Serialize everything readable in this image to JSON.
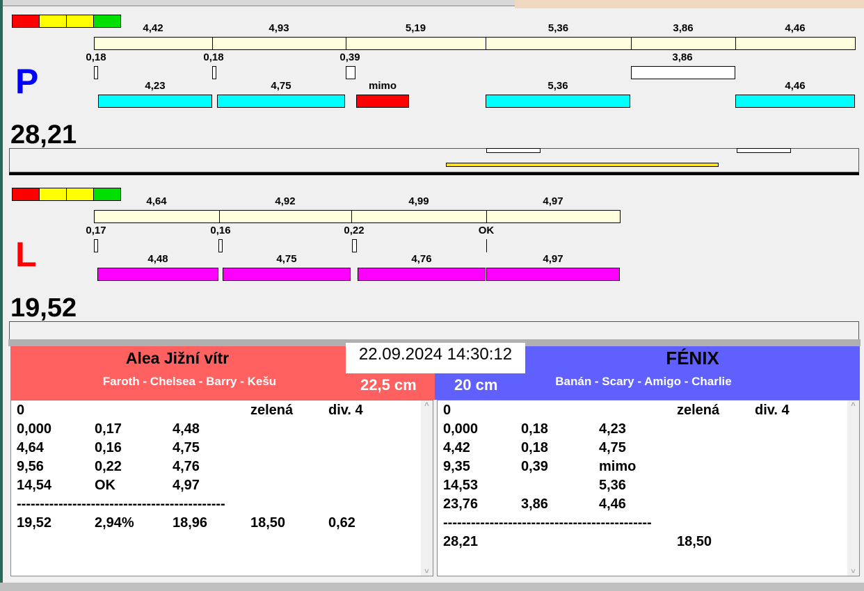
{
  "colors": {
    "red": "#ff0000",
    "yellow": "#ffff00",
    "green": "#00e000",
    "ruler": "#fffedd",
    "cyan": "#00ffff",
    "magenta": "#ff00ff",
    "headerP": "#6060ff",
    "headerL": "#ff6060"
  },
  "P": {
    "letter": "P",
    "total": "28,21",
    "ruler": [
      "4,42",
      "4,93",
      "5,19",
      "5,36",
      "3,86",
      "4,46"
    ],
    "markers": [
      "0,18",
      "0,18",
      "0,39",
      "3,86"
    ],
    "bars": [
      {
        "label": "4,23",
        "color": "cyan"
      },
      {
        "label": "4,75",
        "color": "cyan"
      },
      {
        "label": "mimo",
        "color": "red"
      },
      {
        "label": "5,36",
        "color": "cyan"
      },
      {
        "label": "4,46",
        "color": "cyan"
      }
    ]
  },
  "L": {
    "letter": "L",
    "total": "19,52",
    "ruler": [
      "4,64",
      "4,92",
      "4,99",
      "4,97"
    ],
    "markers": [
      "0,17",
      "0,16",
      "0,22",
      "OK"
    ],
    "bars": [
      {
        "label": "4,48",
        "color": "magenta"
      },
      {
        "label": "4,75",
        "color": "magenta"
      },
      {
        "label": "4,76",
        "color": "magenta"
      },
      {
        "label": "4,97",
        "color": "magenta"
      }
    ]
  },
  "datetime": "22.09.2024 14:30:12",
  "left_team": {
    "name": "Alea Jižní vítr",
    "dogs": "Faroth - Chelsea - Barry - Kešu",
    "height": "22,5 cm",
    "rows": [
      [
        "0",
        "",
        "",
        "zelená",
        "div. 4"
      ],
      [
        "0,000",
        "0,17",
        "4,48",
        "",
        ""
      ],
      [
        "4,64",
        "0,16",
        "4,75",
        "",
        ""
      ],
      [
        "9,56",
        "0,22",
        "4,76",
        "",
        ""
      ],
      [
        "14,54",
        "OK",
        "4,97",
        "",
        ""
      ],
      [
        "---------------------------------------------",
        "",
        "",
        "",
        ""
      ],
      [
        "19,52",
        "2,94%",
        "18,96",
        "18,50",
        "0,62"
      ]
    ]
  },
  "right_team": {
    "name": "FÉNIX",
    "dogs": "Banán - Scary - Amigo - Charlie",
    "height": "20 cm",
    "rows": [
      [
        "0",
        "",
        "",
        "zelená",
        "div. 4"
      ],
      [
        "0,000",
        "0,18",
        "4,23",
        "",
        ""
      ],
      [
        "4,42",
        "0,18",
        "4,75",
        "",
        ""
      ],
      [
        "9,35",
        "0,39",
        "mimo",
        "",
        ""
      ],
      [
        "14,53",
        "",
        "5,36",
        "",
        ""
      ],
      [
        "23,76",
        "3,86",
        "4,46",
        "",
        ""
      ],
      [
        "---------------------------------------------",
        "",
        "",
        "",
        ""
      ],
      [
        "28,21",
        "",
        "",
        "18,50",
        ""
      ]
    ]
  }
}
